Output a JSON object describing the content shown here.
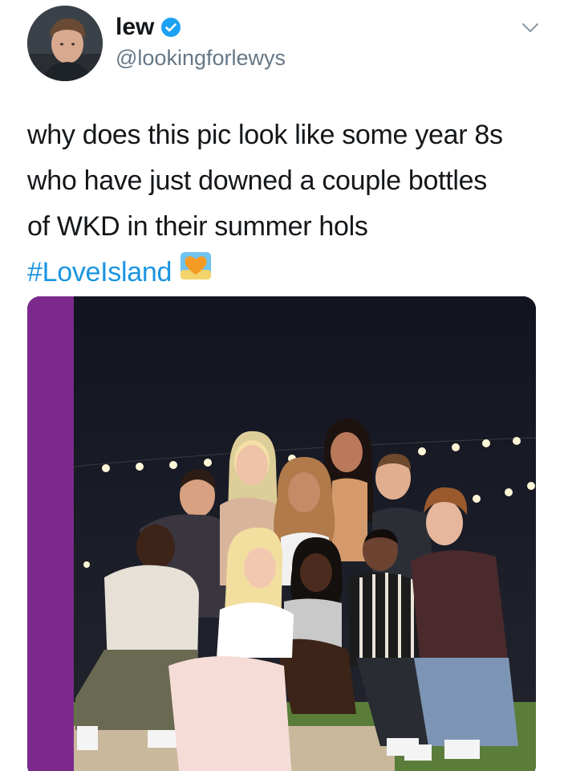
{
  "user": {
    "display_name": "lew",
    "handle": "@lookingforlewys",
    "verified": true,
    "avatar_icon": "profile-photo"
  },
  "tweet": {
    "text_lines": [
      "why does this pic look like some year 8s",
      "who have just downed a couple bottles",
      "of WKD in their summer hols"
    ],
    "hashtag": "#LoveIsland",
    "hashflag_icon": "love-island-heart-icon"
  },
  "menu": {
    "caret_icon": "chevron-down-icon"
  },
  "colors": {
    "link": "#1b95e0",
    "verified": "#1da1f2",
    "handle": "#657786",
    "text": "#14171a",
    "media_side_bar": "#7b2a8c"
  }
}
